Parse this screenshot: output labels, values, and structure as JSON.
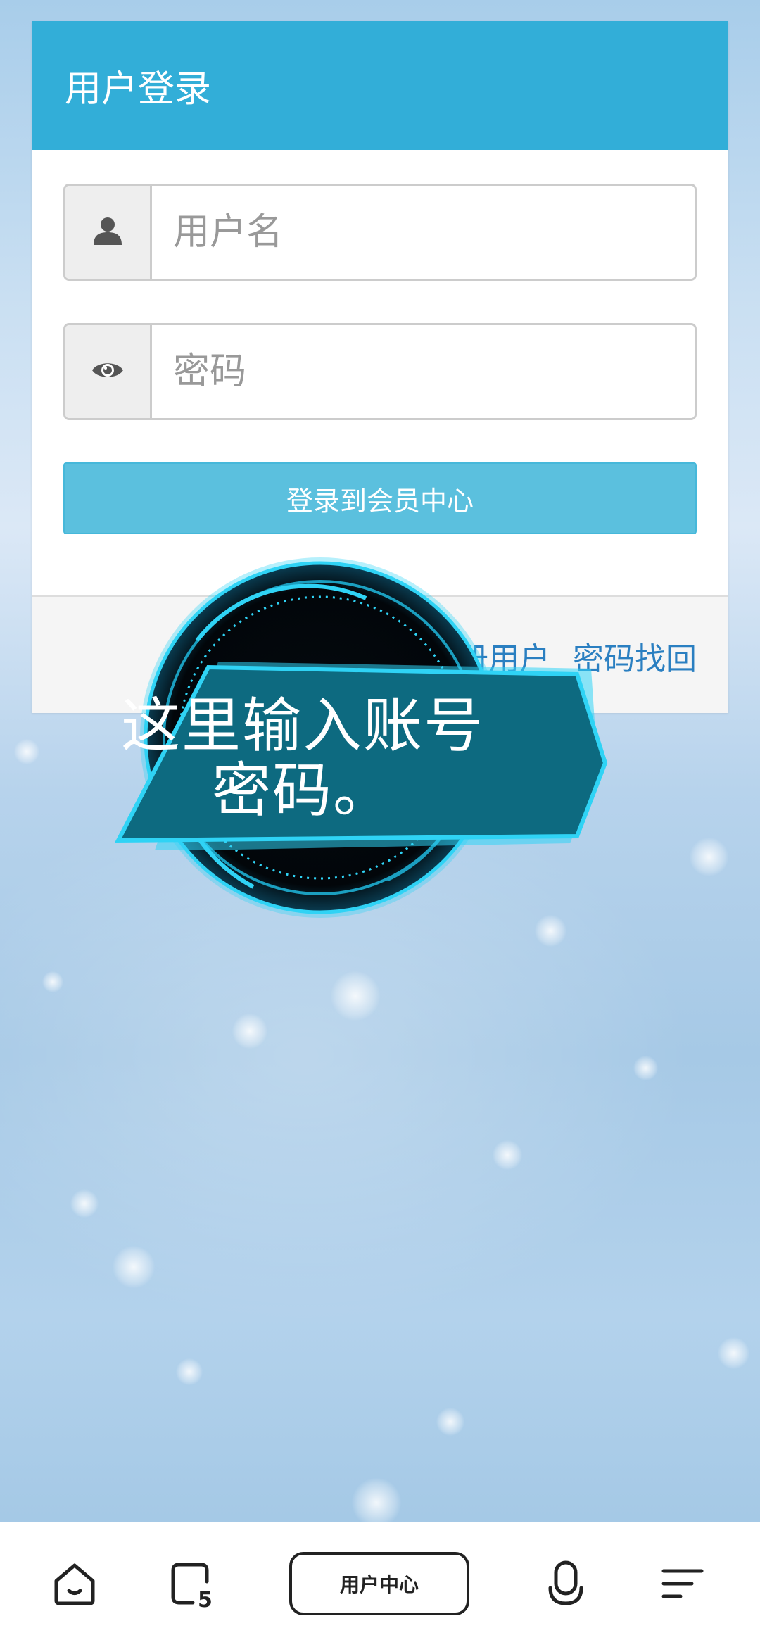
{
  "login": {
    "title": "用户登录",
    "username_placeholder": "用户名",
    "password_placeholder": "密码",
    "submit_label": "登录到会员中心",
    "register_link": "注册用户",
    "recover_link": "密码找回"
  },
  "tooltip": {
    "text_line1": "这里输入账号",
    "text_line2": "密码。"
  },
  "bottom_nav": {
    "tabs_count": "5",
    "center_label": "用户中心",
    "icons": [
      "home-icon",
      "tabs-icon",
      "microphone-icon",
      "menu-icon"
    ]
  },
  "colors": {
    "header": "#32aed8",
    "button": "#5bc0de",
    "link": "#2a7fc1",
    "tooltip_fill": "#0d6a80",
    "tooltip_glow": "#2fd3f5"
  }
}
